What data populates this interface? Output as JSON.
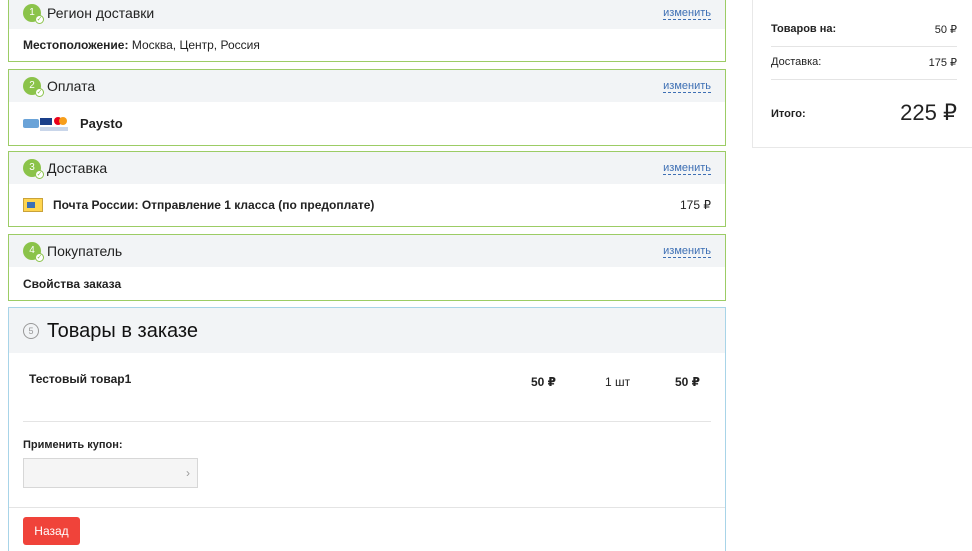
{
  "steps": [
    {
      "num": "1",
      "title": "Регион доставки",
      "change": "изменить",
      "body_label": "Местоположение:",
      "body_value": "Москва, Центр, Россия"
    },
    {
      "num": "2",
      "title": "Оплата",
      "change": "изменить",
      "body_value": "Paysto"
    },
    {
      "num": "3",
      "title": "Доставка",
      "change": "изменить",
      "body_value": "Почта России: Отправление 1 класса (по предоплате)",
      "price": "175 ₽"
    },
    {
      "num": "4",
      "title": "Покупатель",
      "change": "изменить",
      "body_value": "Свойства заказа"
    }
  ],
  "products": {
    "num": "5",
    "title": "Товары в заказе",
    "item": {
      "name": "Тестовый товар1",
      "price": "50 ₽",
      "qty": "1 шт",
      "sum": "50 ₽"
    },
    "coupon_label": "Применить купон:",
    "coupon_arrow": "›",
    "back_label": "Назад"
  },
  "summary": {
    "goods_label": "Товаров на:",
    "goods_value": "50 ₽",
    "delivery_label": "Доставка:",
    "delivery_value": "175 ₽",
    "total_label": "Итого:",
    "total_value": "225 ₽"
  },
  "colors": {
    "step_border": "#9ccc65",
    "step_badge": "#8bc34a",
    "link": "#3d6fb4",
    "back_button": "#f0433a"
  },
  "icons": {
    "check": "check-icon",
    "payment": "payment-cards-icon",
    "post": "russian-post-icon",
    "arrow": "chevron-right-icon"
  }
}
